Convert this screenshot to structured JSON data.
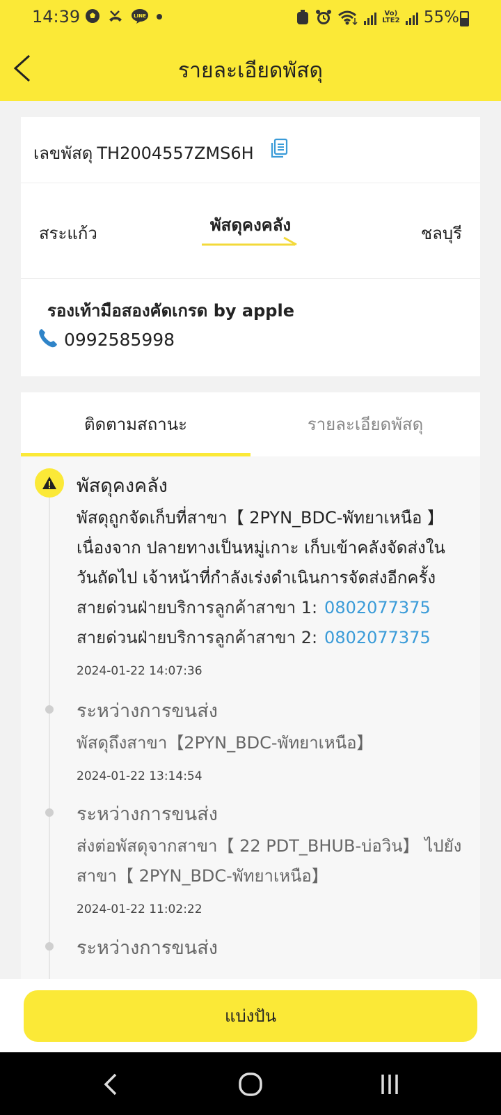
{
  "status_bar": {
    "time": "14:39",
    "lte_label": "Vo) LTE2",
    "battery": "55%",
    "left_icons": [
      "football-icon",
      "missed-call-icon",
      "line-app-icon",
      "dot-icon"
    ],
    "right_icons": [
      "trash-notification-icon",
      "alarm-icon",
      "wifi-icon",
      "signal-icon",
      "signal-icon",
      "battery-icon"
    ]
  },
  "header": {
    "title": "รายละเอียดพัสดุ"
  },
  "parcel": {
    "tracking_label": "เลขพัสดุ",
    "tracking_no": "TH2004557ZMS6H",
    "origin": "สระแก้ว",
    "status": "พัสดุคงคลัง",
    "destination": "ชลบุรี",
    "shop_name": "รองเท้ามือสองคัดเกรด by apple",
    "phone": "0992585998"
  },
  "tabs": {
    "track": "ติดตามสถานะ",
    "detail": "รายละเอียดพัสดุ",
    "active": "track"
  },
  "timeline": [
    {
      "title": "พัสดุคงคลัง",
      "desc": [
        "พัสดุถูกจัดเก็บที่สาขา【 2PYN_BDC-พัทยาเหนือ 】",
        "เนื่องจาก ปลายทางเป็นหมู่เกาะ เก็บเข้าคลังจัดส่งใน",
        "วันถัดไป เจ้าหน้าที่กำลังเร่งดำเนินการจัดส่งอีกครั้ง"
      ],
      "hotline_1_label": "สายด่วนฝ่ายบริการลูกค้าสาขา 1:",
      "hotline_1": "0802077375",
      "hotline_2_label": "สายด่วนฝ่ายบริการลูกค้าสาขา 2:",
      "hotline_2": "0802077375",
      "time": "2024-01-22 14:07:36"
    },
    {
      "title": "ระหว่างการขนส่ง",
      "desc": [
        "พัสดุถึงสาขา【2PYN_BDC-พัทยาเหนือ】"
      ],
      "time": "2024-01-22 13:14:54"
    },
    {
      "title": "ระหว่างการขนส่ง",
      "desc": [
        "ส่งต่อพัสดุจากสาขา【 22 PDT_BHUB-บ่อวิน】 ไปยัง",
        "สาขา【 2PYN_BDC-พัทยาเหนือ】"
      ],
      "time": "2024-01-22 11:02:22"
    },
    {
      "title": "ระหว่างการขนส่ง"
    }
  ],
  "actions": {
    "split_label": "แบ่งปัน"
  },
  "colors": {
    "brand_yellow": "#fbe937",
    "link_blue": "#3a9bd8"
  }
}
